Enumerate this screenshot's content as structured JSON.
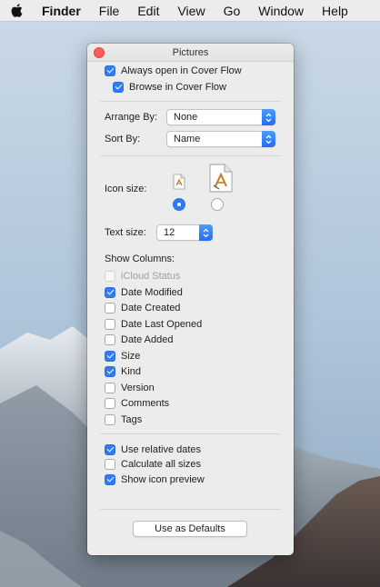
{
  "menubar": {
    "app_name": "Finder",
    "items": [
      "File",
      "Edit",
      "View",
      "Go",
      "Window",
      "Help"
    ]
  },
  "window": {
    "title": "Pictures",
    "always_open_cover_flow": {
      "label": "Always open in Cover Flow",
      "checked": true
    },
    "browse_cover_flow": {
      "label": "Browse in Cover Flow",
      "checked": true
    },
    "arrange_by": {
      "label": "Arrange By:",
      "value": "None"
    },
    "sort_by": {
      "label": "Sort By:",
      "value": "Name"
    },
    "icon_size": {
      "label": "Icon size:",
      "selected": "small"
    },
    "text_size": {
      "label": "Text size:",
      "value": "12"
    },
    "show_columns": {
      "label": "Show Columns:",
      "items": [
        {
          "label": "iCloud Status",
          "checked": false,
          "disabled": true
        },
        {
          "label": "Date Modified",
          "checked": true
        },
        {
          "label": "Date Created",
          "checked": false
        },
        {
          "label": "Date Last Opened",
          "checked": false
        },
        {
          "label": "Date Added",
          "checked": false
        },
        {
          "label": "Size",
          "checked": true
        },
        {
          "label": "Kind",
          "checked": true
        },
        {
          "label": "Version",
          "checked": false
        },
        {
          "label": "Comments",
          "checked": false
        },
        {
          "label": "Tags",
          "checked": false
        }
      ]
    },
    "options": [
      {
        "label": "Use relative dates",
        "checked": true
      },
      {
        "label": "Calculate all sizes",
        "checked": false
      },
      {
        "label": "Show icon preview",
        "checked": true
      }
    ],
    "defaults_button": "Use as Defaults"
  },
  "colors": {
    "accent": "#2f7cf6",
    "close": "#fc5f57",
    "window_bg": "#ececec"
  }
}
